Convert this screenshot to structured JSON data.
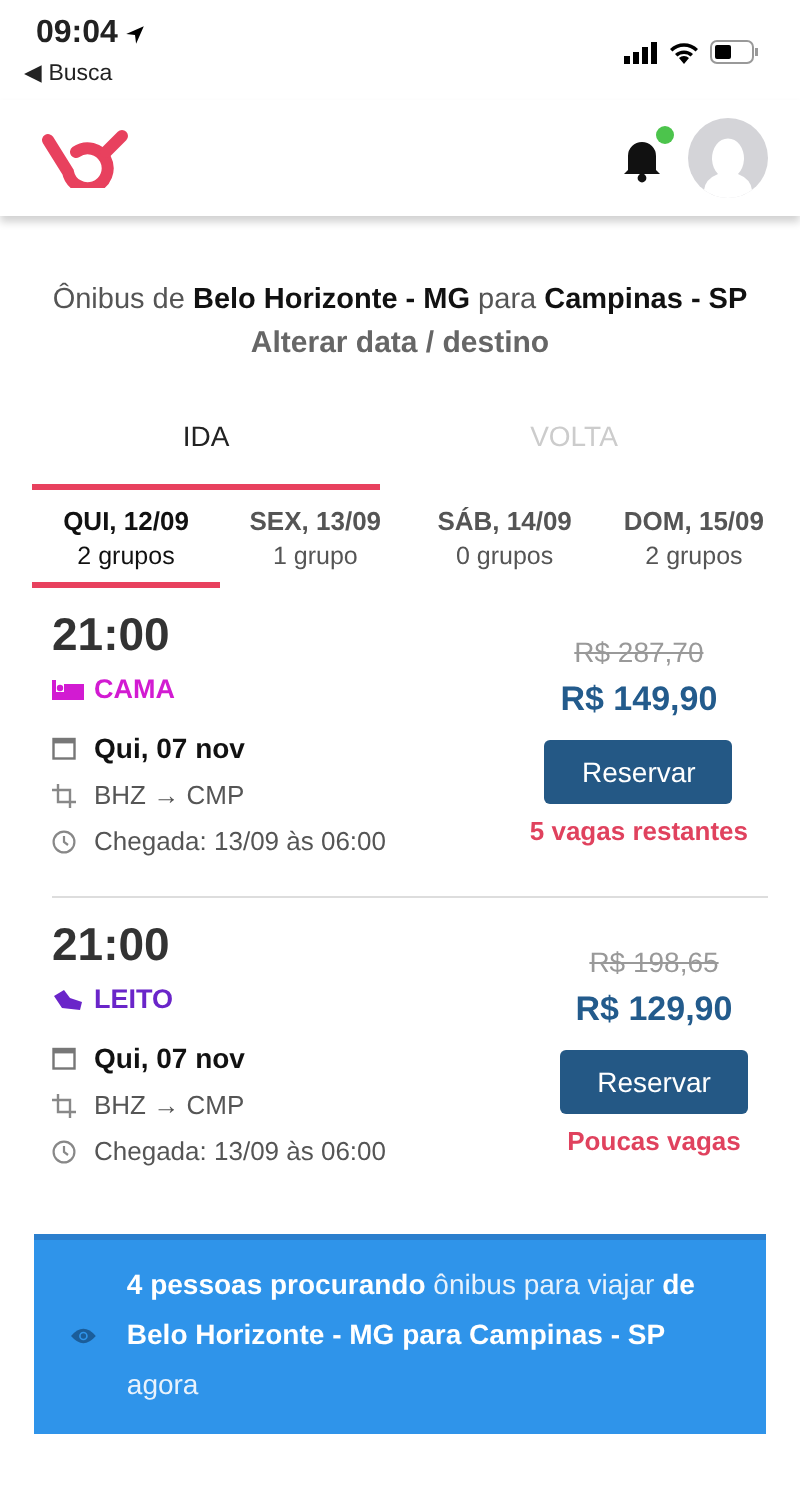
{
  "status_bar": {
    "time": "09:04",
    "back_label": "◀ Busca"
  },
  "header": {
    "notification_dot": true
  },
  "route": {
    "title": "Ônibus de **Belo Horizonte - MG** para **Campinas - SP**",
    "change_link": "Alterar data / destino"
  },
  "tabs": [
    {
      "label": "IDA",
      "selected": true
    },
    {
      "label": "VOLTA",
      "selected": false
    }
  ],
  "days": [
    {
      "label": "QUI, 12/09",
      "groups": "2 grupos",
      "selected": true
    },
    {
      "label": "SEX, 13/09",
      "groups": "1 grupo",
      "selected": false
    },
    {
      "label": "SÁB, 14/09",
      "groups": "0 grupos",
      "selected": false
    },
    {
      "label": "DOM, 15/09",
      "groups": "2 grupos",
      "selected": false
    }
  ],
  "trips": [
    {
      "time": "21:00",
      "kind": "cama",
      "seat_type": "CAMA",
      "color": "#d21bd2",
      "date": "Qui, 07 nov",
      "route": "BHZ → CMP",
      "arrival": "Chegada: 13/09 às 06:00",
      "old_price": "R$ 287,70",
      "price": "R$ 149,90",
      "button": "Reservar",
      "availability": "5 vagas restantes"
    },
    {
      "time": "21:00",
      "kind": "leito",
      "seat_type": "LEITO",
      "color": "#6a25c9",
      "date": "Qui, 07 nov",
      "route": "BHZ → CMP",
      "arrival": "Chegada: 13/09 às 06:00",
      "old_price": "R$ 198,65",
      "price": "R$ 129,90",
      "button": "Reservar",
      "availability": "Poucas vagas"
    }
  ],
  "banner": {
    "text": "**4 pessoas procurando** ônibus para viajar **de Belo Horizonte - MG para Campinas - SP** agora"
  }
}
